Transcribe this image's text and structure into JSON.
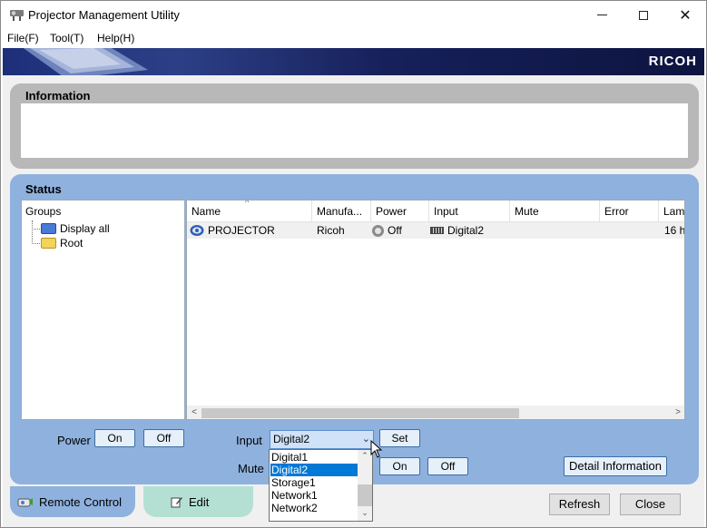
{
  "window": {
    "title": "Projector Management Utility",
    "min_icon": "minimize-icon",
    "max_icon": "maximize-icon",
    "close_glyph": "✕"
  },
  "menu": {
    "items": [
      "File(F)",
      "Tool(T)",
      "Help(H)"
    ]
  },
  "banner": {
    "brand": "RICOH"
  },
  "information": {
    "title": "Information"
  },
  "status": {
    "title": "Status",
    "groups_label": "Groups",
    "tree": [
      {
        "label": "Display all",
        "icon": "folder-blue-icon"
      },
      {
        "label": "Root",
        "icon": "folder-yellow-icon"
      }
    ],
    "columns": [
      "Name",
      "Manufa...",
      "Power",
      "Input",
      "Mute",
      "Error",
      "Lam"
    ],
    "rows": [
      {
        "name": "PROJECTOR",
        "manufacturer": "Ricoh",
        "power": "Off",
        "input": "Digital2",
        "mute": "",
        "error": "",
        "lamp": "16 h"
      }
    ]
  },
  "controls": {
    "power_label": "Power",
    "power_on": "On",
    "power_off": "Off",
    "input_label": "Input",
    "input_value": "Digital2",
    "set": "Set",
    "mute_label": "Mute",
    "mute_on": "On",
    "mute_off": "Off",
    "detail": "Detail Information",
    "input_options": [
      "Digital1",
      "Digital2",
      "Storage1",
      "Network1",
      "Network2"
    ],
    "selected_option": "Digital2"
  },
  "tabs": {
    "remote": "Remote Control",
    "edit": "Edit"
  },
  "footer": {
    "refresh": "Refresh",
    "close": "Close"
  },
  "colors": {
    "status_panel": "#8fb1de",
    "info_panel": "#b8b8b8",
    "edit_tab": "#b4e0d4",
    "selection": "#0078d7"
  }
}
